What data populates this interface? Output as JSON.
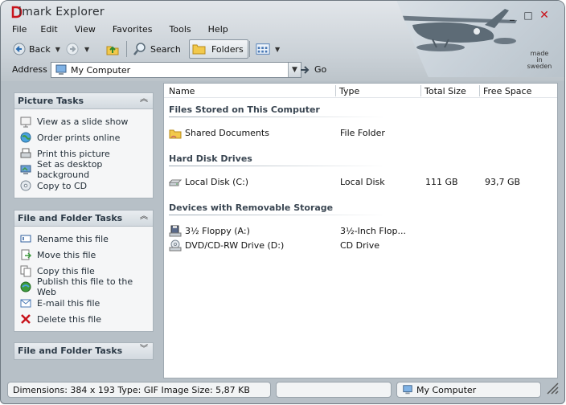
{
  "window": {
    "title": "imark Explorer",
    "logo_text": "",
    "controls": {
      "minimize": "_",
      "maximize": "□",
      "close": "✕"
    },
    "badge_text": [
      "made",
      "in",
      "sweden"
    ]
  },
  "menu": [
    "File",
    "Edit",
    "View",
    "Favorites",
    "Tools",
    "Help"
  ],
  "toolbar": {
    "back_label": "Back",
    "search_label": "Search",
    "folders_label": "Folders"
  },
  "address": {
    "label": "Address",
    "value": "My Computer",
    "go_label": "Go"
  },
  "picture_tasks": {
    "title": "Picture Tasks",
    "items": [
      {
        "label": "View as a slide show",
        "icon": "slideshow-icon"
      },
      {
        "label": "Order prints online",
        "icon": "globe-icon"
      },
      {
        "label": "Print this picture",
        "icon": "printer-icon"
      },
      {
        "label": "Set as desktop background",
        "icon": "desktop-icon"
      },
      {
        "label": "Copy to CD",
        "icon": "cd-icon"
      }
    ]
  },
  "file_folder_tasks": {
    "title": "File and Folder Tasks",
    "items": [
      {
        "label": "Rename this file",
        "icon": "rename-icon"
      },
      {
        "label": "Move this file",
        "icon": "move-icon"
      },
      {
        "label": "Copy this file",
        "icon": "copy-icon"
      },
      {
        "label": "Publish this file to the Web",
        "icon": "publish-icon"
      },
      {
        "label": "E-mail this file",
        "icon": "email-icon"
      },
      {
        "label": "Delete this file",
        "icon": "delete-icon"
      }
    ]
  },
  "collapsed_panel": {
    "title": "File and Folder Tasks"
  },
  "columns": {
    "name": "Name",
    "type": "Type",
    "total": "Total Size",
    "free": "Free Space"
  },
  "groups": {
    "stored": {
      "title": "Files Stored on This Computer",
      "rows": [
        {
          "name": "Shared Documents",
          "type": "File Folder",
          "total": "",
          "free": ""
        }
      ]
    },
    "hdd": {
      "title": "Hard Disk Drives",
      "rows": [
        {
          "name": "Local Disk (C:)",
          "type": "Local Disk",
          "total": "111 GB",
          "free": "93,7 GB"
        }
      ]
    },
    "removable": {
      "title": "Devices with Removable Storage",
      "rows": [
        {
          "name": "3½ Floppy (A:)",
          "type": "3½-Inch Flop...",
          "total": "",
          "free": ""
        },
        {
          "name": "DVD/CD-RW Drive (D:)",
          "type": "CD Drive",
          "total": "",
          "free": ""
        }
      ]
    }
  },
  "status": {
    "info": "Dimensions: 384 x 193 Type: GIF Image Size: 5,87 KB",
    "middle": "",
    "location": "My Computer"
  },
  "colors": {
    "accent_red": "#c8141c",
    "chrome": "#b7c0c7",
    "panel_title": "#2c3a47"
  }
}
